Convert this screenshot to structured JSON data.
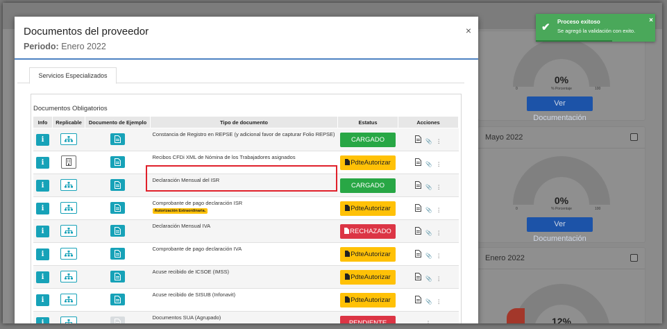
{
  "modal": {
    "title": "Documentos del proveedor",
    "period_label": "Periodo:",
    "period_value": "Enero 2022",
    "close": "×",
    "tab": "Servicios Especializados",
    "panel_title": "Documentos Obligatorios"
  },
  "table": {
    "headers": [
      "Info",
      "Replicable",
      "Documento de Ejemplo",
      "Tipo de documento",
      "Estatus",
      "Acciones"
    ],
    "rows": [
      {
        "tipo": "Constancia de Registro en REPSE (y adicional favor de capturar Folio REPSE)",
        "estatus": "CARGADO"
      },
      {
        "tipo": "Recibos CFDi XML de Nómina de los Trabajadores asignados",
        "estatus": "PdteAutorizar"
      },
      {
        "tipo": "Declaración Mensual del ISR",
        "estatus": "CARGADO"
      },
      {
        "tipo": "Comprobante de pago declaración ISR",
        "badge": "Autorización Extraordinaria.",
        "estatus": "PdteAutorizar"
      },
      {
        "tipo": "Declaración Mensual IVA",
        "estatus": "RECHAZADO"
      },
      {
        "tipo": "Comprobante de pago declaración IVA",
        "estatus": "PdteAutorizar"
      },
      {
        "tipo": "Acuse recibido de ICSOE (IMSS)",
        "estatus": "PdteAutorizar"
      },
      {
        "tipo": "Acuse recibido de SISUB (Infonavit)",
        "estatus": "PdteAutorizar"
      },
      {
        "tipo": "Documentos SUA (Agrupado)",
        "estatus": "PENDIENTE"
      }
    ],
    "info_glyph": "i"
  },
  "toast": {
    "title": "Proceso exitoso",
    "message": "Se agregó la validación con exito.",
    "close": "×"
  },
  "background": {
    "card1": {
      "pct": "0%",
      "sub": "% Porcentaje",
      "min": "0",
      "max": "100",
      "button": "Ver Documentación"
    },
    "card2": {
      "title": "Mayo 2022",
      "pct": "0%",
      "sub": "% Porcentaje",
      "min": "0",
      "max": "100",
      "button": "Ver Documentación"
    },
    "card3": {
      "title": "Enero 2022",
      "pct": "12%"
    }
  },
  "colors": {
    "info": "#17a2b8",
    "cargado": "#28a745",
    "pendiente_autorizar": "#ffc107",
    "rechazado": "#dc3545",
    "toast": "#4aa85a",
    "highlight": "#e0202a"
  }
}
